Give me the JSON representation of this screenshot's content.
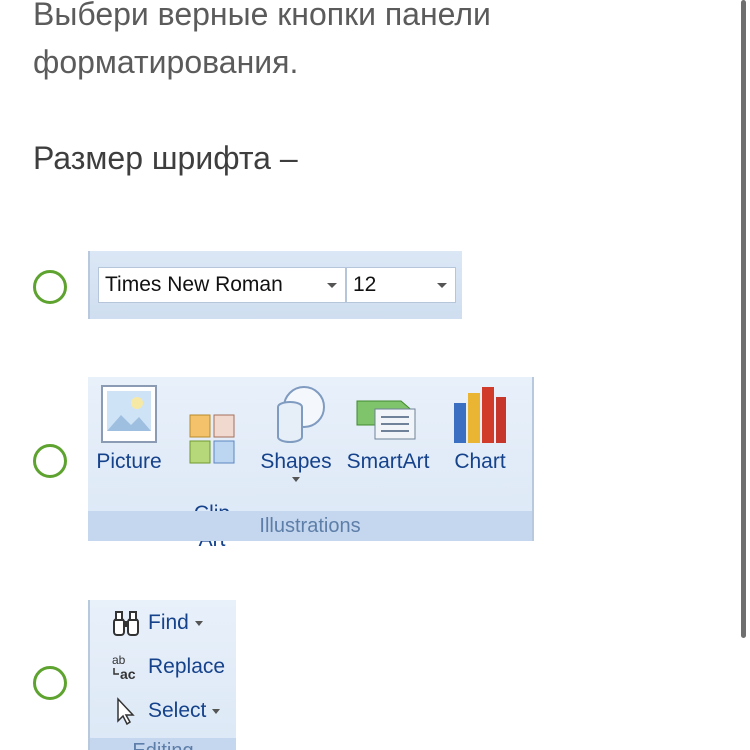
{
  "question": "Выбери верные кнопки панели форматирования.",
  "prompt": "Размер шрифта –",
  "colors": {
    "radio_border": "#5ea32f",
    "ribbon_text": "#15428b"
  },
  "options": [
    {
      "font_name": "Times New Roman",
      "font_size": "12"
    },
    {
      "items": [
        {
          "label": "Picture",
          "icon": "picture-icon"
        },
        {
          "label": "Clip\nArt",
          "icon": "clip-art-icon"
        },
        {
          "label": "Shapes",
          "icon": "shapes-icon"
        },
        {
          "label": "SmartArt",
          "icon": "smartart-icon"
        },
        {
          "label": "Chart",
          "icon": "chart-icon"
        }
      ],
      "group_label": "Illustrations"
    },
    {
      "items": [
        {
          "label": "Find",
          "icon": "binoculars-icon"
        },
        {
          "label": "Replace",
          "icon": "replace-icon"
        },
        {
          "label": "Select",
          "icon": "cursor-icon"
        }
      ],
      "group_label": "Editing"
    }
  ]
}
